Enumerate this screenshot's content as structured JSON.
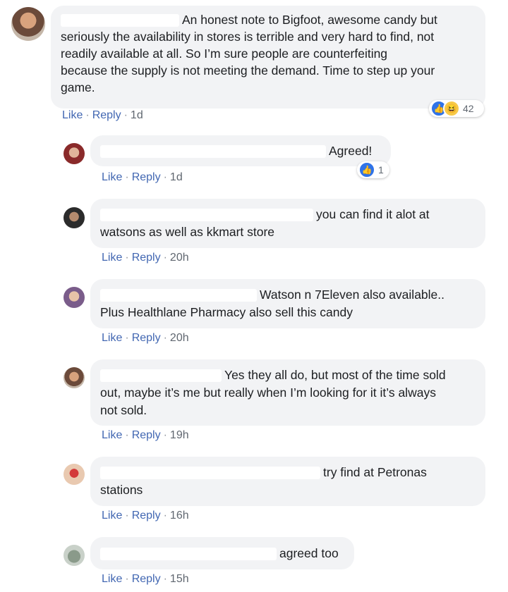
{
  "main_comment": {
    "text": "An honest note to Bigfoot, awesome candy but seriously the availability in stores is terrible and very hard to find, not readily available at all. So I’m sure people are counterfeiting because the supply is not meeting the demand. Time to step up your game.",
    "line1": "An honest note to Bigfoot, awesome candy but",
    "line2": "seriously the availability in stores is terrible and very hard to find, not",
    "line3": "readily available at all. So I’m sure people are counterfeiting",
    "line4": "because the supply is not meeting the demand. Time to step up your",
    "line5": "game.",
    "like": "Like",
    "reply": "Reply",
    "time": "1d",
    "reaction_count": "42"
  },
  "replies": [
    {
      "line1": "Agreed!",
      "line2": "",
      "like": "Like",
      "reply": "Reply",
      "time": "1d",
      "reaction_count": "1"
    },
    {
      "line1": "you can find it alot at",
      "line2": "watsons as well as kkmart store",
      "like": "Like",
      "reply": "Reply",
      "time": "20h"
    },
    {
      "line1": "Watson n 7Eleven also available..",
      "line2": "Plus Healthlane Pharmacy also sell this candy",
      "like": "Like",
      "reply": "Reply",
      "time": "20h"
    },
    {
      "line1": "Yes they all do, but most of the time sold",
      "line2": "out, maybe it’s me but really when I’m looking for it it’s always",
      "line3": "not sold.",
      "like": "Like",
      "reply": "Reply",
      "time": "19h"
    },
    {
      "line1": "try find at Petronas",
      "line2": "stations",
      "like": "Like",
      "reply": "Reply",
      "time": "16h"
    },
    {
      "line1": "agreed too",
      "line2": "",
      "like": "Like",
      "reply": "Reply",
      "time": "15h"
    }
  ],
  "separator": "·",
  "icons": {
    "like": "thumbs-up-icon",
    "haha": "laughing-face-icon"
  },
  "colors": {
    "link": "#4267b2",
    "bubble": "#f2f3f5",
    "like_icon": "#2f73e8"
  }
}
